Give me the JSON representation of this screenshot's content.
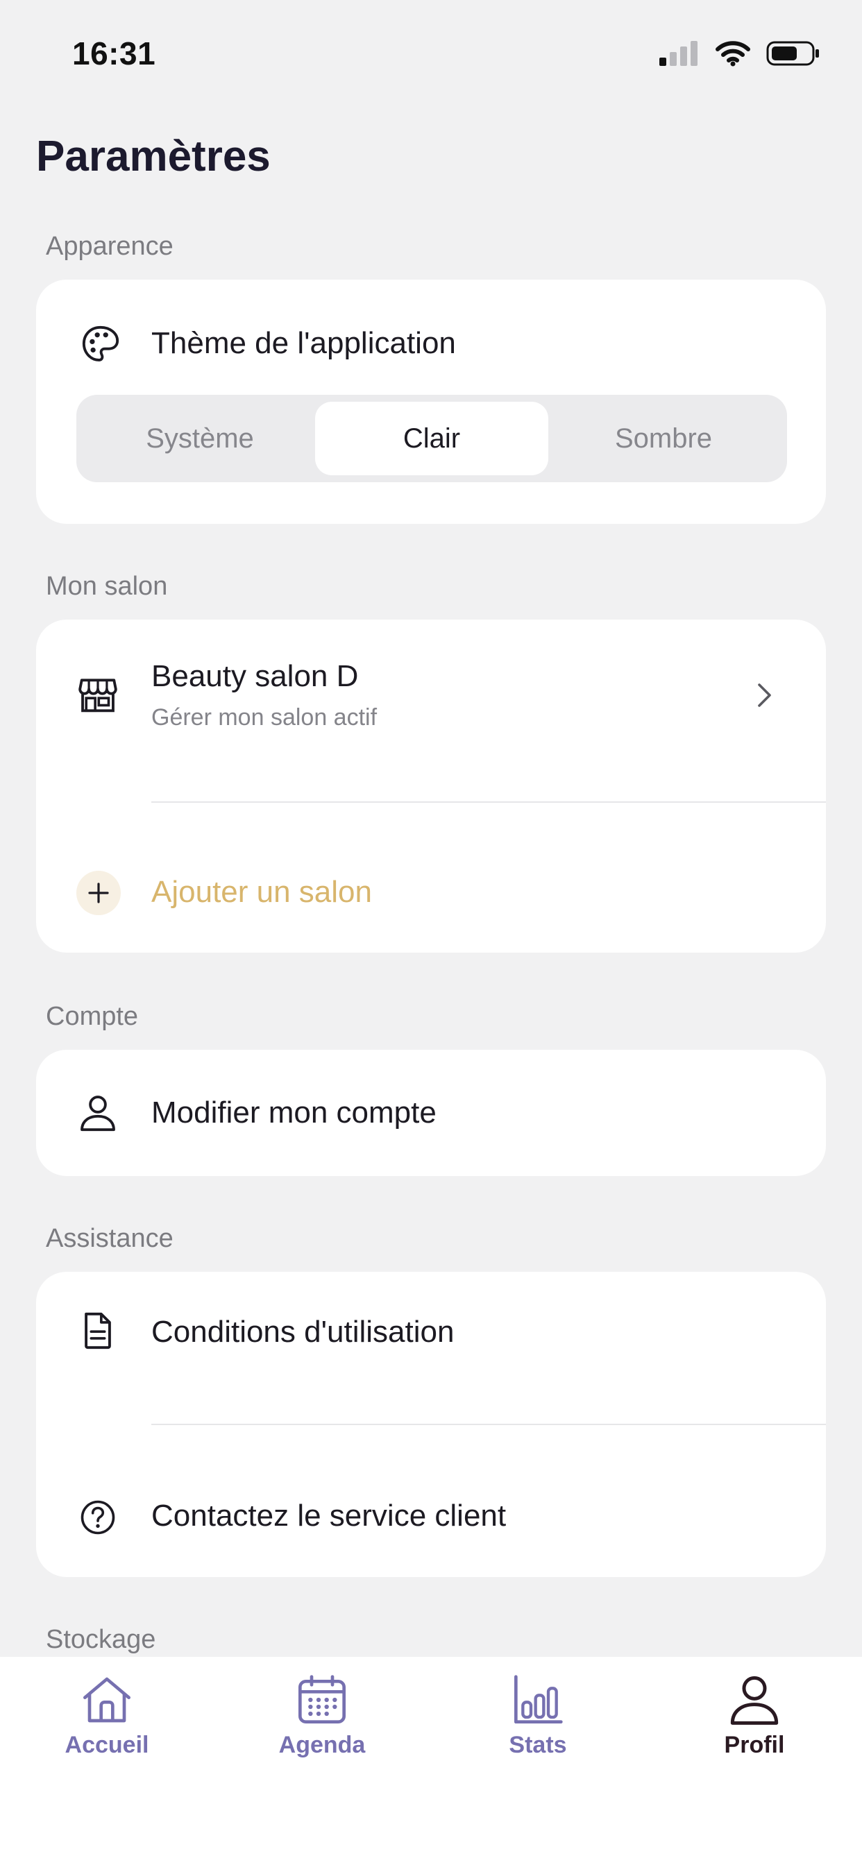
{
  "status_bar": {
    "time": "16:31"
  },
  "page": {
    "title": "Paramètres"
  },
  "appearance": {
    "section_label": "Apparence",
    "theme_label": "Thème de l'application",
    "options": [
      "Système",
      "Clair",
      "Sombre"
    ],
    "selected": "Clair"
  },
  "salon": {
    "section_label": "Mon salon",
    "name": "Beauty salon D",
    "subtitle": "Gérer mon salon actif",
    "add_label": "Ajouter un salon"
  },
  "account": {
    "section_label": "Compte",
    "edit_label": "Modifier mon compte"
  },
  "support": {
    "section_label": "Assistance",
    "terms_label": "Conditions d'utilisation",
    "contact_label": "Contactez le service client"
  },
  "storage": {
    "section_label": "Stockage"
  },
  "tabs": [
    {
      "label": "Accueil",
      "icon": "home-icon"
    },
    {
      "label": "Agenda",
      "icon": "calendar-icon"
    },
    {
      "label": "Stats",
      "icon": "bar-chart-icon"
    },
    {
      "label": "Profil",
      "icon": "user-icon",
      "active": true
    }
  ],
  "colors": {
    "accent_gold": "#d8b56c",
    "tab_inactive": "#7670b0",
    "tab_active": "#2a1a22",
    "background": "#f1f1f2"
  }
}
